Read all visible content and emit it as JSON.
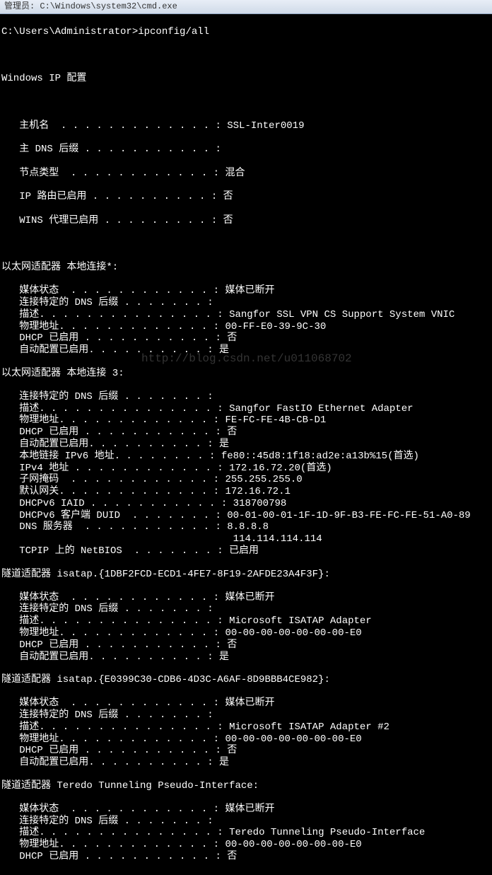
{
  "titlebar": "管理员: C:\\Windows\\system32\\cmd.exe",
  "prompt": "C:\\Users\\Administrator>ipconfig/all",
  "watermark": "http://blog.csdn.net/u011068702",
  "header": "Windows IP 配置",
  "global": {
    "hostname_label": "   主机名  . . . . . . . . . . . . . : ",
    "hostname_value": "SSL-Inter0019",
    "dnssuffix_label": "   主 DNS 后缀 . . . . . . . . . . . : ",
    "dnssuffix_value": "",
    "nodetype_label": "   节点类型  . . . . . . . . . . . . : ",
    "nodetype_value": "混合",
    "iprouting_label": "   IP 路由已启用 . . . . . . . . . . : ",
    "iprouting_value": "否",
    "wins_label": "   WINS 代理已启用 . . . . . . . . . : ",
    "wins_value": "否"
  },
  "adapters": [
    {
      "title": "以太网适配器 本地连接*:",
      "rows": [
        {
          "label": "   媒体状态  . . . . . . . . . . . . : ",
          "value": "媒体已断开"
        },
        {
          "label": "   连接特定的 DNS 后缀 . . . . . . . : ",
          "value": ""
        },
        {
          "label": "   描述. . . . . . . . . . . . . . . : ",
          "value": "Sangfor SSL VPN CS Support System VNIC"
        },
        {
          "label": "   物理地址. . . . . . . . . . . . . : ",
          "value": "00-FF-E0-39-9C-30"
        },
        {
          "label": "   DHCP 已启用 . . . . . . . . . . . : ",
          "value": "否"
        },
        {
          "label": "   自动配置已启用. . . . . . . . . . : ",
          "value": "是"
        }
      ]
    },
    {
      "title": "以太网适配器 本地连接 3:",
      "rows": [
        {
          "label": "   连接特定的 DNS 后缀 . . . . . . . : ",
          "value": ""
        },
        {
          "label": "   描述. . . . . . . . . . . . . . . : ",
          "value": "Sangfor FastIO Ethernet Adapter"
        },
        {
          "label": "   物理地址. . . . . . . . . . . . . : ",
          "value": "FE-FC-FE-4B-CB-D1"
        },
        {
          "label": "   DHCP 已启用 . . . . . . . . . . . : ",
          "value": "否"
        },
        {
          "label": "   自动配置已启用. . . . . . . . . . : ",
          "value": "是"
        },
        {
          "label": "   本地链接 IPv6 地址. . . . . . . . : ",
          "value": "fe80::45d8:1f18:ad2e:a13b%15(首选)"
        },
        {
          "label": "   IPv4 地址 . . . . . . . . . . . . : ",
          "value": "172.16.72.20(首选)"
        },
        {
          "label": "   子网掩码  . . . . . . . . . . . . : ",
          "value": "255.255.255.0"
        },
        {
          "label": "   默认网关. . . . . . . . . . . . . : ",
          "value": "172.16.72.1"
        },
        {
          "label": "   DHCPv6 IAID . . . . . . . . . . . : ",
          "value": "318700798"
        },
        {
          "label": "   DHCPv6 客户端 DUID  . . . . . . . : ",
          "value": "00-01-00-01-1F-1D-9F-B3-FE-FC-FE-51-A0-89"
        },
        {
          "label": "   DNS 服务器  . . . . . . . . . . . : ",
          "value": "8.8.8.8"
        },
        {
          "label": "                                       ",
          "value": "114.114.114.114"
        },
        {
          "label": "   TCPIP 上的 NetBIOS  . . . . . . . : ",
          "value": "已启用"
        }
      ]
    },
    {
      "title": "隧道适配器 isatap.{1DBF2FCD-ECD1-4FE7-8F19-2AFDE23A4F3F}:",
      "rows": [
        {
          "label": "   媒体状态  . . . . . . . . . . . . : ",
          "value": "媒体已断开"
        },
        {
          "label": "   连接特定的 DNS 后缀 . . . . . . . : ",
          "value": ""
        },
        {
          "label": "   描述. . . . . . . . . . . . . . . : ",
          "value": "Microsoft ISATAP Adapter"
        },
        {
          "label": "   物理地址. . . . . . . . . . . . . : ",
          "value": "00-00-00-00-00-00-00-E0"
        },
        {
          "label": "   DHCP 已启用 . . . . . . . . . . . : ",
          "value": "否"
        },
        {
          "label": "   自动配置已启用. . . . . . . . . . : ",
          "value": "是"
        }
      ]
    },
    {
      "title": "隧道适配器 isatap.{E0399C30-CDB6-4D3C-A6AF-8D9BBB4CE982}:",
      "rows": [
        {
          "label": "   媒体状态  . . . . . . . . . . . . : ",
          "value": "媒体已断开"
        },
        {
          "label": "   连接特定的 DNS 后缀 . . . . . . . : ",
          "value": ""
        },
        {
          "label": "   描述. . . . . . . . . . . . . . . : ",
          "value": "Microsoft ISATAP Adapter #2"
        },
        {
          "label": "   物理地址. . . . . . . . . . . . . : ",
          "value": "00-00-00-00-00-00-00-E0"
        },
        {
          "label": "   DHCP 已启用 . . . . . . . . . . . : ",
          "value": "否"
        },
        {
          "label": "   自动配置已启用. . . . . . . . . . : ",
          "value": "是"
        }
      ]
    },
    {
      "title": "隧道适配器 Teredo Tunneling Pseudo-Interface:",
      "rows": [
        {
          "label": "   媒体状态  . . . . . . . . . . . . : ",
          "value": "媒体已断开"
        },
        {
          "label": "   连接特定的 DNS 后缀 . . . . . . . : ",
          "value": ""
        },
        {
          "label": "   描述. . . . . . . . . . . . . . . : ",
          "value": "Teredo Tunneling Pseudo-Interface"
        },
        {
          "label": "   物理地址. . . . . . . . . . . . . : ",
          "value": "00-00-00-00-00-00-00-E0"
        },
        {
          "label": "   DHCP 已启用 . . . . . . . . . . . : ",
          "value": "否"
        }
      ]
    }
  ]
}
